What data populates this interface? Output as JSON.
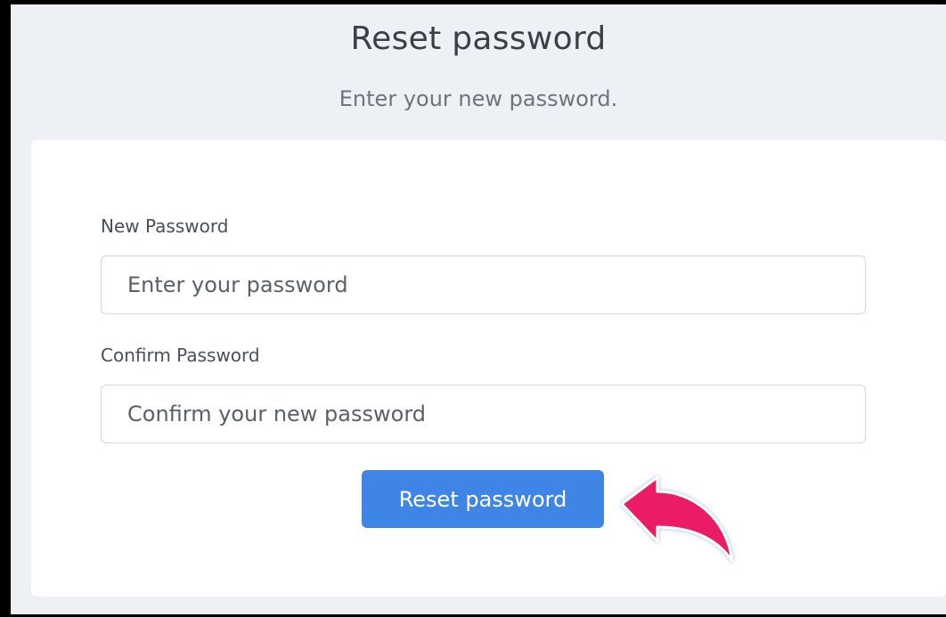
{
  "page": {
    "title": "Reset password",
    "subtitle": "Enter your new password."
  },
  "form": {
    "new_password": {
      "label": "New Password",
      "placeholder": "Enter your password",
      "value": ""
    },
    "confirm_password": {
      "label": "Confirm Password",
      "placeholder": "Confirm your new password",
      "value": ""
    },
    "submit_label": "Reset password"
  },
  "annotation": {
    "icon": "curved-arrow-icon",
    "color": "#ea1c67"
  },
  "colors": {
    "background": "#edf0f5",
    "button": "#3f85e6",
    "title_text": "#3b3f46"
  }
}
